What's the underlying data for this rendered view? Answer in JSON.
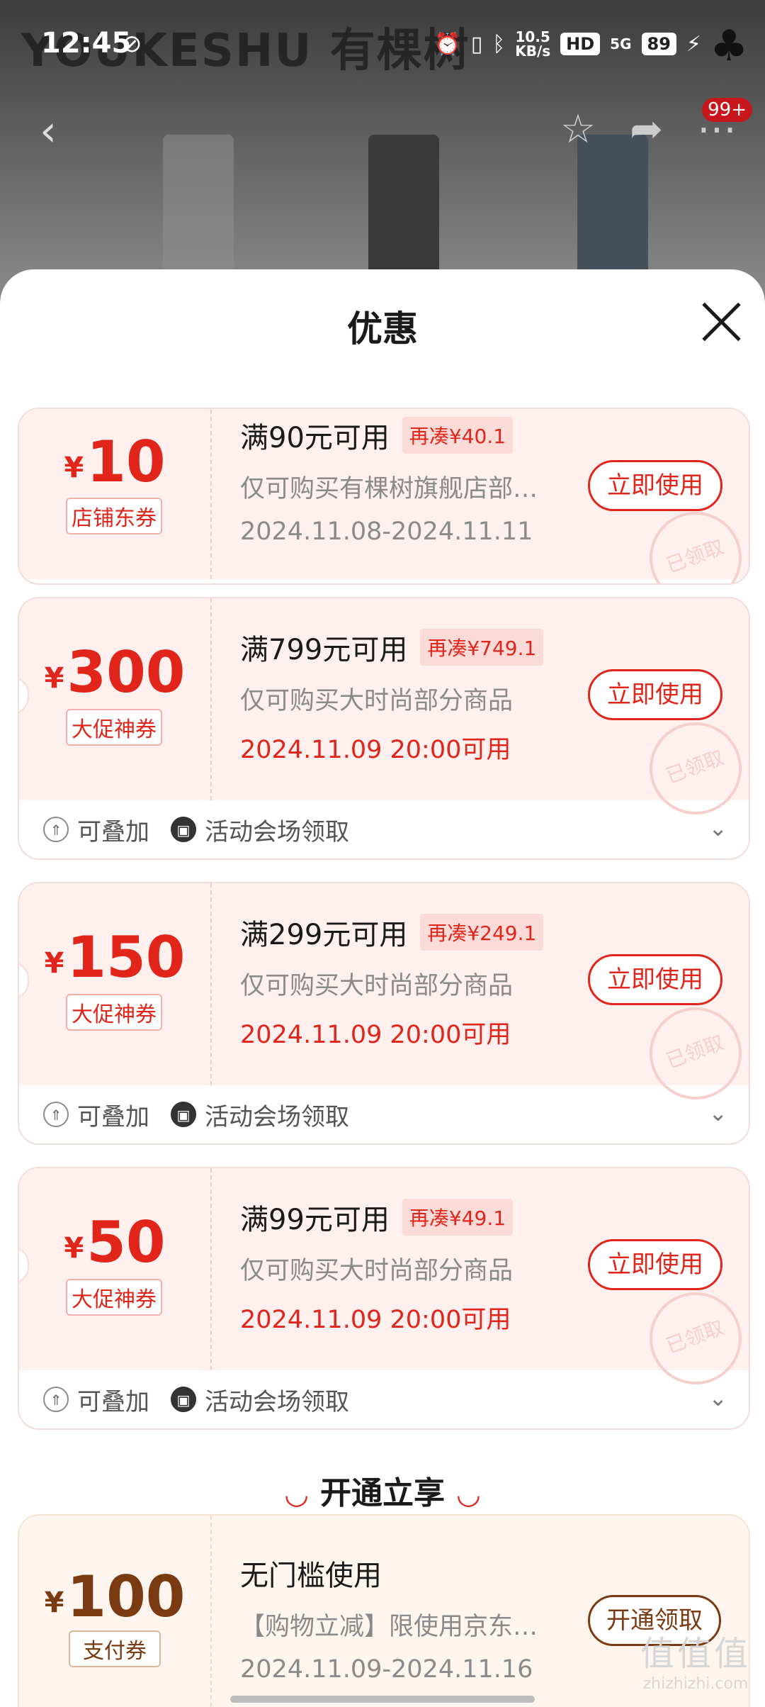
{
  "status_bar": {
    "time": "12:45",
    "net_speed_value": "10.5",
    "net_speed_unit": "KB/s",
    "hd": "HD",
    "signal": "5G",
    "battery": "89"
  },
  "backdrop": {
    "brand": "YOUKESHU 有棵树",
    "badge": "99+"
  },
  "sheet": {
    "title": "优惠"
  },
  "coupons": [
    {
      "currency": "¥",
      "amount": "10",
      "kind": "店铺东券",
      "condition": "满90元可用",
      "diff": "再凑¥40.1",
      "scope": "仅可购买有棵树旗舰店部…",
      "date": "2024.11.08-2024.11.11",
      "button": "立即使用",
      "stamp": "已领取"
    },
    {
      "currency": "¥",
      "amount": "300",
      "kind": "大促神券",
      "condition": "满799元可用",
      "diff": "再凑¥749.1",
      "scope": "仅可购买大时尚部分商品",
      "date": "2024.11.09 20:00可用",
      "button": "立即使用",
      "stamp": "已领取",
      "tag1": "可叠加",
      "tag2": "活动会场领取"
    },
    {
      "currency": "¥",
      "amount": "150",
      "kind": "大促神券",
      "condition": "满299元可用",
      "diff": "再凑¥249.1",
      "scope": "仅可购买大时尚部分商品",
      "date": "2024.11.09 20:00可用",
      "button": "立即使用",
      "stamp": "已领取",
      "tag1": "可叠加",
      "tag2": "活动会场领取"
    },
    {
      "currency": "¥",
      "amount": "50",
      "kind": "大促神券",
      "condition": "满99元可用",
      "diff": "再凑¥49.1",
      "scope": "仅可购买大时尚部分商品",
      "date": "2024.11.09 20:00可用",
      "button": "立即使用",
      "stamp": "已领取",
      "tag1": "可叠加",
      "tag2": "活动会场领取"
    }
  ],
  "section": {
    "title": "开通立享"
  },
  "pay_coupon": {
    "currency": "¥",
    "amount": "100",
    "kind": "支付券",
    "condition": "无门槛使用",
    "scope": "【购物立减】限使用京东支…",
    "date": "2024.11.09-2024.11.16",
    "button": "开通领取"
  },
  "watermark": {
    "big": "值值值",
    "small": "zhizhizhi.com"
  },
  "colors": {
    "accent": "#e1251b",
    "pay_accent": "#7a3a12"
  }
}
